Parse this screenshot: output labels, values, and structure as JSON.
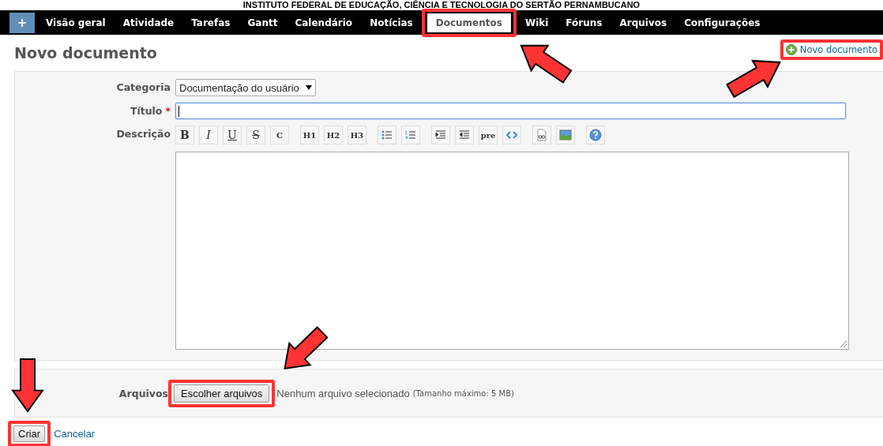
{
  "banner": "INSTITUTO FEDERAL DE EDUCAÇÃO, CIÊNCIA E TECNOLOGIA DO SERTÃO PERNAMBUCANO",
  "add_button": {
    "label": "+"
  },
  "tabs": [
    {
      "label": "Visão geral",
      "selected": false,
      "highlighted": false
    },
    {
      "label": "Atividade",
      "selected": false,
      "highlighted": false
    },
    {
      "label": "Tarefas",
      "selected": false,
      "highlighted": false
    },
    {
      "label": "Gantt",
      "selected": false,
      "highlighted": false
    },
    {
      "label": "Calendário",
      "selected": false,
      "highlighted": false
    },
    {
      "label": "Notícias",
      "selected": false,
      "highlighted": false
    },
    {
      "label": "Documentos",
      "selected": true,
      "highlighted": true
    },
    {
      "label": "Wiki",
      "selected": false,
      "highlighted": false
    },
    {
      "label": "Fóruns",
      "selected": false,
      "highlighted": false
    },
    {
      "label": "Arquivos",
      "selected": false,
      "highlighted": false
    },
    {
      "label": "Configurações",
      "selected": false,
      "highlighted": false
    }
  ],
  "page_title": "Novo documento",
  "new_document_link": {
    "label": "Novo documento",
    "highlighted": true
  },
  "form": {
    "category": {
      "label": "Categoria",
      "value": "Documentação do usuário"
    },
    "title": {
      "label": "Título",
      "required_mark": "*",
      "focused": true
    },
    "description": {
      "label": "Descrição",
      "toolbar_groups": [
        [
          {
            "kind": "bold",
            "label": "B"
          },
          {
            "kind": "italic",
            "label": "I"
          },
          {
            "kind": "underline",
            "label": "U"
          },
          {
            "kind": "strike",
            "label": "S"
          },
          {
            "kind": "plain",
            "label": "C"
          }
        ],
        [
          {
            "kind": "plain",
            "label": "H1"
          },
          {
            "kind": "plain",
            "label": "H2"
          },
          {
            "kind": "plain",
            "label": "H3"
          }
        ],
        [
          {
            "kind": "bullets"
          },
          {
            "kind": "numbers"
          }
        ],
        [
          {
            "kind": "indent"
          },
          {
            "kind": "outdent"
          },
          {
            "kind": "plain",
            "label": "pre"
          },
          {
            "kind": "code"
          }
        ],
        [
          {
            "kind": "link"
          },
          {
            "kind": "image"
          }
        ],
        [
          {
            "kind": "help"
          }
        ]
      ]
    }
  },
  "attachments": {
    "label": "Arquivos",
    "button": {
      "label": "Escolher arquivos",
      "highlighted": true
    },
    "status": "Nenhum arquivo selecionado",
    "hint": "(Tamanho máximo: 5 MB)"
  },
  "actions": [
    {
      "kind": "button",
      "label": "Criar",
      "highlighted": true
    },
    {
      "kind": "link",
      "label": "Cancelar",
      "highlighted": false
    }
  ]
}
